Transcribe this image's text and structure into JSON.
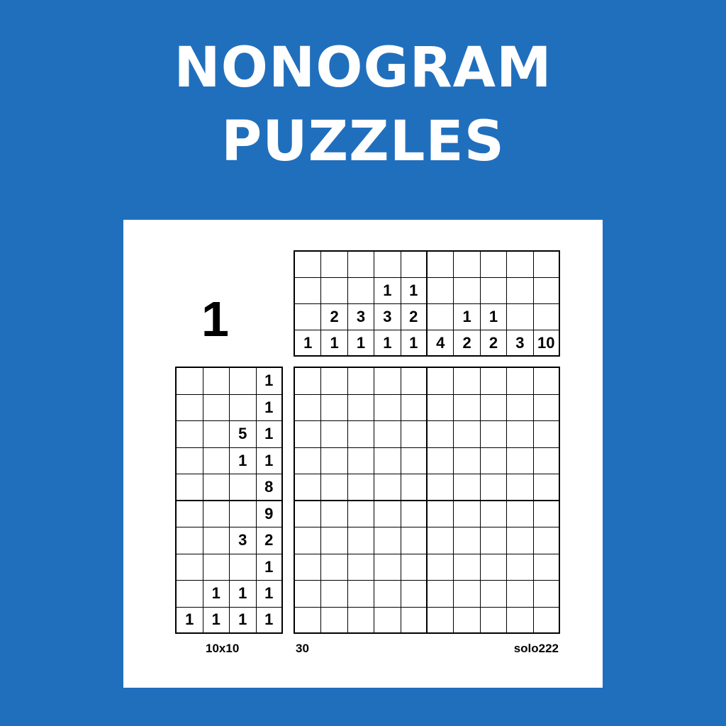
{
  "header": {
    "title_line_1": "NONOGRAM",
    "title_line_2": "PUZZLES"
  },
  "puzzle": {
    "number": "1",
    "size_label": "10x10",
    "id_label": "30",
    "author_label": "solo222",
    "column_clues": [
      [
        "",
        "",
        "",
        "1"
      ],
      [
        "",
        "",
        "2",
        "1"
      ],
      [
        "",
        "",
        "3",
        "1"
      ],
      [
        "",
        "1",
        "3",
        "1"
      ],
      [
        "",
        "1",
        "2",
        "1"
      ],
      [
        "",
        "",
        "",
        "4"
      ],
      [
        "",
        "",
        "1",
        "2"
      ],
      [
        "",
        "",
        "1",
        "2"
      ],
      [
        "",
        "",
        "",
        "3"
      ],
      [
        "",
        "",
        "",
        "10"
      ]
    ],
    "row_clues": [
      [
        "",
        "",
        "",
        "1"
      ],
      [
        "",
        "",
        "",
        "1"
      ],
      [
        "",
        "",
        "5",
        "1"
      ],
      [
        "",
        "",
        "1",
        "1"
      ],
      [
        "",
        "",
        "",
        "8"
      ],
      [
        "",
        "",
        "",
        "9"
      ],
      [
        "",
        "",
        "3",
        "2"
      ],
      [
        "",
        "",
        "",
        "1"
      ],
      [
        "",
        "1",
        "1",
        "1"
      ],
      [
        "1",
        "1",
        "1",
        "1"
      ]
    ]
  },
  "colors": {
    "background": "#206fbd",
    "card": "#ffffff",
    "ink": "#000000"
  }
}
